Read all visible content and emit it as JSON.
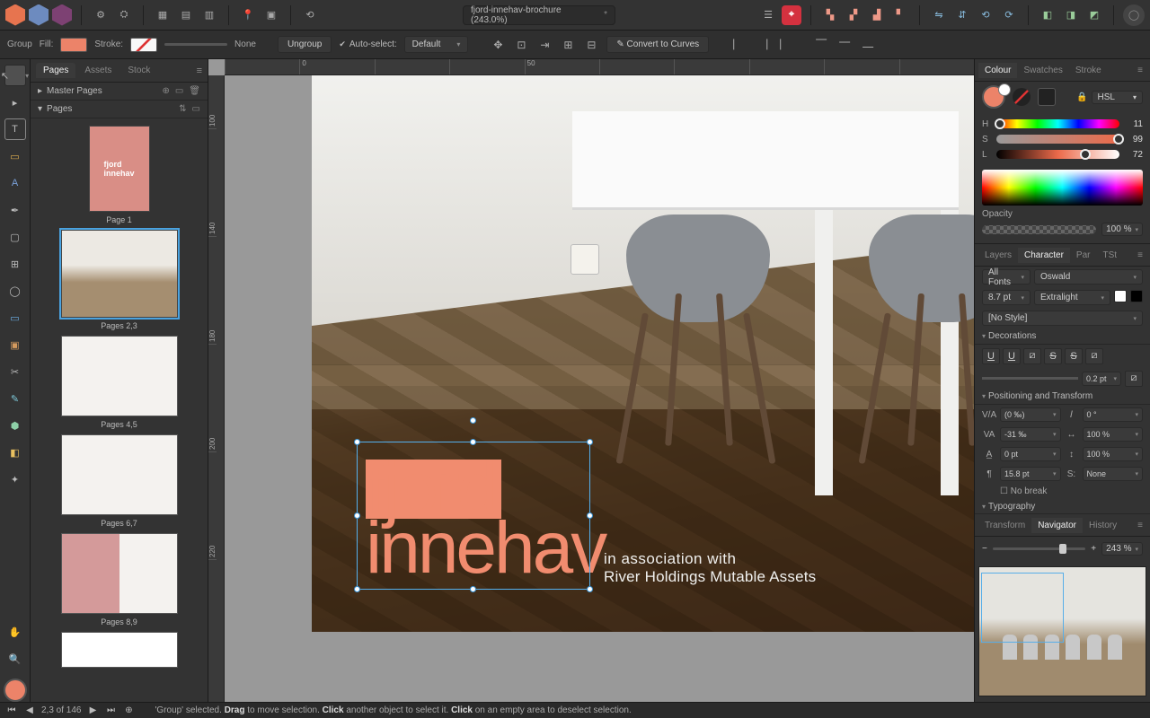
{
  "document": {
    "name": "fjord-innehav-brochure",
    "zoom": "243.0%",
    "dirty": "*"
  },
  "context": {
    "selection_type": "Group",
    "fill_label": "Fill:",
    "stroke_label": "Stroke:",
    "stroke_value": "None",
    "ungroup": "Ungroup",
    "autoselect": "Auto-select:",
    "autoselect_mode": "Default",
    "curves": "Convert to Curves"
  },
  "pages_panel": {
    "tabs": [
      "Pages",
      "Assets",
      "Stock"
    ],
    "master": "Master Pages",
    "pages_header": "Pages",
    "items": [
      {
        "label": "Page 1"
      },
      {
        "label": "Pages 2,3"
      },
      {
        "label": "Pages 4,5"
      },
      {
        "label": "Pages 6,7"
      },
      {
        "label": "Pages 8,9"
      }
    ]
  },
  "artwork": {
    "logo_line1": "fjord",
    "logo_line2": "innehav",
    "assoc_l1": "in association with",
    "assoc_l2": "River Holdings Mutable Assets"
  },
  "color_panel": {
    "tabs": [
      "Colour",
      "Swatches",
      "Stroke"
    ],
    "model": "HSL",
    "H": {
      "label": "H",
      "value": "11"
    },
    "S": {
      "label": "S",
      "value": "99"
    },
    "L": {
      "label": "L",
      "value": "72"
    },
    "opacity_label": "Opacity",
    "opacity": "100 %"
  },
  "layers_tabs": [
    "Layers",
    "Character",
    "Par",
    "TSt"
  ],
  "character": {
    "fontset": "All Fonts",
    "family": "Oswald",
    "size": "8.7 pt",
    "weight": "Extralight",
    "style": "[No Style]",
    "decorations_label": "Decorations",
    "dec_size": "0.2 pt",
    "pt_label": "Positioning and Transform",
    "kerning": "(0 ‰)",
    "tracking": "-31 ‰",
    "baseline": "0 pt",
    "leading": "15.8 pt",
    "shear": "0 °",
    "hscale": "100 %",
    "vscale": "100 %",
    "lang": "None",
    "nobreak": "No break",
    "typo_label": "Typography"
  },
  "nav_tabs": [
    "Transform",
    "Navigator",
    "History"
  ],
  "nav_zoom": "243 %",
  "status": {
    "page": "2,3 of 146",
    "msg_sel": "'Group' selected.",
    "msg_drag": "Drag",
    "msg_drag2": " to move selection. ",
    "msg_click": "Click",
    "msg_click2": " another object to select it. ",
    "msg_click3": "Click",
    "msg_click4": " on an empty area to deselect selection."
  },
  "ruler_h": [
    "",
    "0",
    "",
    "",
    "50",
    "",
    "",
    "",
    "",
    ""
  ],
  "ruler_v": [
    "100",
    "",
    "140",
    "",
    "180",
    "",
    "200",
    "",
    "220"
  ]
}
